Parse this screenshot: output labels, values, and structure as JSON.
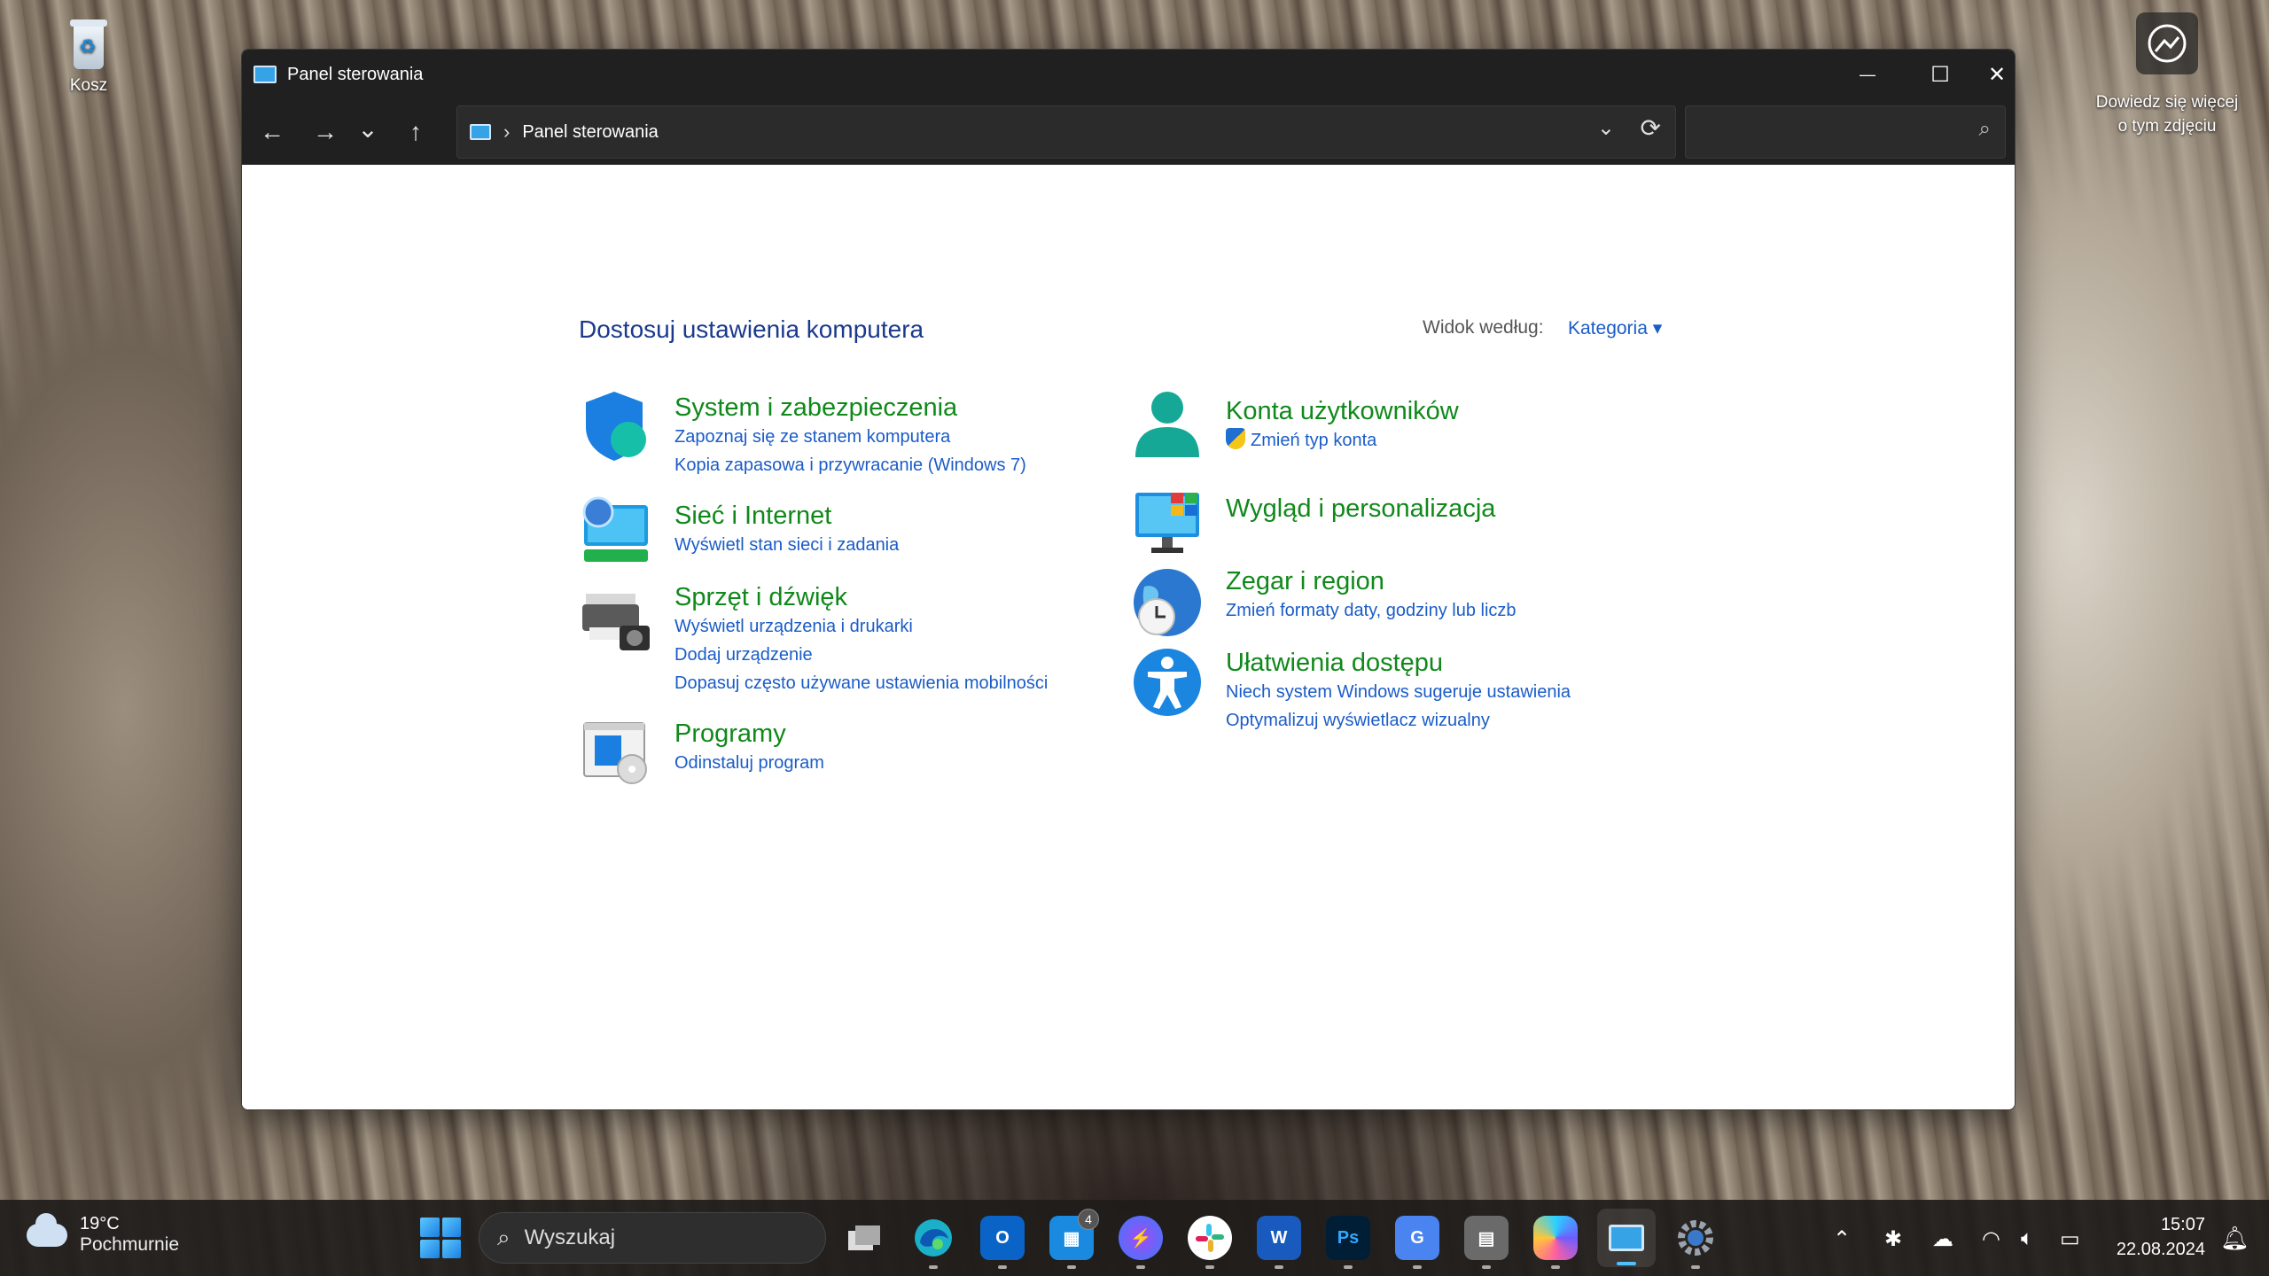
{
  "desktop": {
    "recycle_bin_label": "Kosz",
    "spotlight_label": "Dowiedz się więcej o tym zdjęciu"
  },
  "window": {
    "title": "Panel sterowania",
    "minimize_glyph": "—",
    "maximize_glyph": "☐",
    "close_glyph": "✕"
  },
  "nav": {
    "back_glyph": "←",
    "forward_glyph": "→",
    "recent_glyph": "⌄",
    "up_glyph": "↑",
    "breadcrumb": "Panel sterowania",
    "search_value": ""
  },
  "content": {
    "heading": "Dostosuj ustawienia komputera",
    "view_by_label": "Widok według:",
    "view_by_value": "Kategoria ▾",
    "categories": [
      {
        "title": "System i zabezpieczenia",
        "icon": "shield-icon",
        "links": [
          "Zapoznaj się ze stanem komputera",
          "Kopia zapasowa i przywracanie (Windows 7)"
        ]
      },
      {
        "title": "Sieć i Internet",
        "icon": "network-globe-icon",
        "links": [
          "Wyświetl stan sieci i zadania"
        ]
      },
      {
        "title": "Sprzęt i dźwięk",
        "icon": "printer-camera-icon",
        "links": [
          "Wyświetl urządzenia i drukarki",
          "Dodaj urządzenie",
          "Dopasuj często używane ustawienia mobilności"
        ]
      },
      {
        "title": "Programy",
        "icon": "programs-icon",
        "links": [
          "Odinstaluj program"
        ]
      },
      {
        "title": "Konta użytkowników",
        "icon": "user-icon",
        "links": [
          "Zmień typ konta"
        ]
      },
      {
        "title": "Wygląd i personalizacja",
        "icon": "monitor-icon",
        "links": []
      },
      {
        "title": "Zegar i region",
        "icon": "clock-globe-icon",
        "links": [
          "Zmień formaty daty, godziny lub liczb"
        ]
      },
      {
        "title": "Ułatwienia dostępu",
        "icon": "accessibility-icon",
        "links": [
          "Niech system Windows sugeruje ustawienia",
          "Optymalizuj wyświetlacz wizualny"
        ]
      }
    ]
  },
  "taskbar": {
    "weather_temp": "19°C",
    "weather_desc": "Pochmurnie",
    "search_placeholder": "Wyszukaj",
    "store_badge": "4",
    "apps": [
      "task-view",
      "edge",
      "outlook",
      "ms-store",
      "messenger",
      "slack",
      "word",
      "photoshop",
      "translate",
      "calculator",
      "copilot",
      "control-panel",
      "settings"
    ],
    "clock_time": "15:07",
    "clock_date": "22.08.2024"
  }
}
